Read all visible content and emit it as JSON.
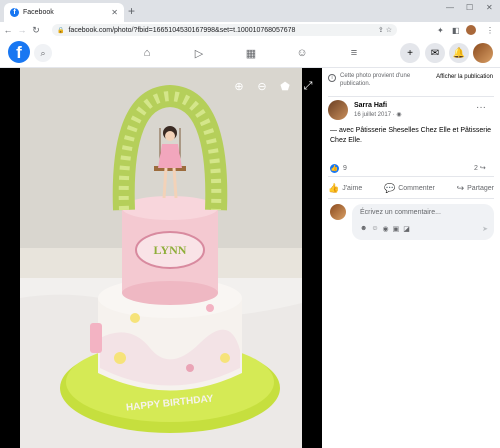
{
  "browser": {
    "tab_title": "Facebook",
    "tab_close": "✕",
    "new_tab": "+",
    "url": "facebook.com/photo/?fbid=1665104530167998&set=t.100010768057678",
    "win_minimize": "—",
    "win_maximize": "☐",
    "win_close": "✕"
  },
  "fb_nav": {
    "logo": "f",
    "search_icon": "search-icon"
  },
  "photo": {
    "zoom_in": "⊕",
    "zoom_out": "⊖",
    "tag": "⬟",
    "fullscreen": "⤢",
    "cake_text_name": "LYNN",
    "cake_text_birthday": "HAPPY BIRTHDAY"
  },
  "sidebar": {
    "notice_text": "Cette photo provient d'une publication.",
    "notice_button": "Afficher la publication",
    "author_name": "Sarra Hafi",
    "post_date": "16 juillet 2017 · ",
    "caption": "— avec Pâtisserie Sheselles Chez Elle et Pâtisserie Chez Elle.",
    "reaction_count": "9",
    "share_count": "2",
    "actions": {
      "like": "J'aime",
      "comment": "Commenter",
      "share": "Partager"
    },
    "comment_placeholder": "Écrivez un commentaire..."
  },
  "colors": {
    "facebook_blue": "#1877f2",
    "text_primary": "#050505",
    "text_secondary": "#65676b"
  }
}
